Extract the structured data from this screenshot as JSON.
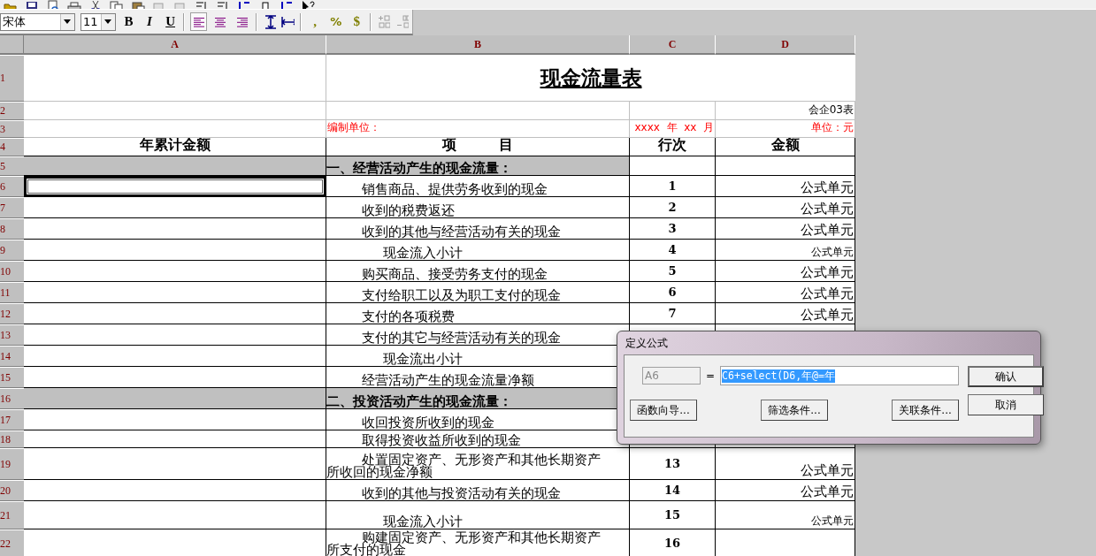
{
  "toolbar": {
    "font": "宋体",
    "size": "11",
    "format_buttons": [
      {
        "label": "B",
        "kind": "bold"
      },
      {
        "label": "I",
        "kind": "italic"
      },
      {
        "label": "U",
        "kind": "underline"
      }
    ],
    "align_buttons": [
      {
        "kind": "left",
        "selected": true
      },
      {
        "kind": "center",
        "selected": false
      },
      {
        "kind": "right",
        "selected": false
      }
    ],
    "number_buttons": [
      {
        "label": ",",
        "kind": "comma"
      },
      {
        "label": "%",
        "kind": "percent"
      },
      {
        "label": "$",
        "kind": "currency"
      }
    ]
  },
  "sheet": {
    "columns": [
      "A",
      "B",
      "C",
      "D"
    ],
    "top_rows": [
      {
        "number": "1"
      },
      {
        "number": "2"
      },
      {
        "number": "3"
      },
      {
        "number": "4"
      }
    ],
    "title": "现金流量表",
    "form_code": "会企03表",
    "preparer_label": "编制单位：",
    "period": "xxxx  年  xx  月",
    "unit": "单位：元",
    "headers": [
      "年累计金额",
      "项　　　目",
      "行次",
      "金额"
    ],
    "rows": [
      {
        "number": "5",
        "kind": "section",
        "item": "一、经营活动产生的现金流量：",
        "selected": false
      },
      {
        "number": "6",
        "kind": "item",
        "item": "销售商品、提供劳务收到的现金",
        "line": "1",
        "amount": "公式单元",
        "selected": true
      },
      {
        "number": "7",
        "kind": "item",
        "item": "收到的税费返还",
        "line": "2",
        "amount": "公式单元",
        "selected": false
      },
      {
        "number": "8",
        "kind": "item",
        "item": "收到的其他与经营活动有关的现金",
        "line": "3",
        "amount": "公式单元",
        "selected": false
      },
      {
        "number": "9",
        "kind": "subtotal",
        "item": "现金流入小计",
        "line": "4",
        "amount": "公式单元",
        "selected": false
      },
      {
        "number": "10",
        "kind": "item",
        "item": "购买商品、接受劳务支付的现金",
        "line": "5",
        "amount": "公式单元",
        "selected": false
      },
      {
        "number": "11",
        "kind": "item",
        "item": "支付给职工以及为职工支付的现金",
        "line": "6",
        "amount": "公式单元",
        "selected": false
      },
      {
        "number": "12",
        "kind": "item",
        "item": "支付的各项税费",
        "line": "7",
        "amount": "公式单元",
        "selected": false
      },
      {
        "number": "13",
        "kind": "item",
        "item": "支付的其它与经营活动有关的现金",
        "selected": false
      },
      {
        "number": "14",
        "kind": "subtotal",
        "item": "现金流出小计",
        "selected": false
      },
      {
        "number": "15",
        "kind": "item",
        "item": "经营活动产生的现金流量净额",
        "selected": false
      },
      {
        "number": "16",
        "kind": "section",
        "item": "二、投资活动产生的现金流量：",
        "selected": false
      },
      {
        "number": "17",
        "kind": "item",
        "item": "收回投资所收到的现金",
        "selected": false
      },
      {
        "number": "18",
        "kind": "item",
        "item": "取得投资收益所收到的现金",
        "selected": false
      },
      {
        "number": "19",
        "kind": "item",
        "item": "处置固定资产、无形资产和其他长期资产所收回的现金净额",
        "line": "13",
        "amount": "公式单元",
        "selected": false
      },
      {
        "number": "20",
        "kind": "item",
        "item": "收到的其他与投资活动有关的现金",
        "line": "14",
        "amount": "公式单元",
        "selected": false
      },
      {
        "number": "21",
        "kind": "subtotal",
        "item": "现金流入小计",
        "line": "15",
        "amount": "公式单元",
        "selected": false
      },
      {
        "number": "22",
        "kind": "item",
        "item": "购建固定资产、无形资产和其他长期资产所支付的现金",
        "line": "16",
        "selected": false
      }
    ]
  },
  "dialog": {
    "title": "定义公式",
    "cell": "A6",
    "cell_disabled": true,
    "equals": "=",
    "formula": "C6+select(D6,年@=年",
    "formula_selected": true,
    "buttons": [
      {
        "label": "确认",
        "default": true
      },
      {
        "label": "取消",
        "default": false
      }
    ],
    "condition_buttons": [
      "函数向导...",
      "筛选条件...",
      "关联条件..."
    ]
  }
}
